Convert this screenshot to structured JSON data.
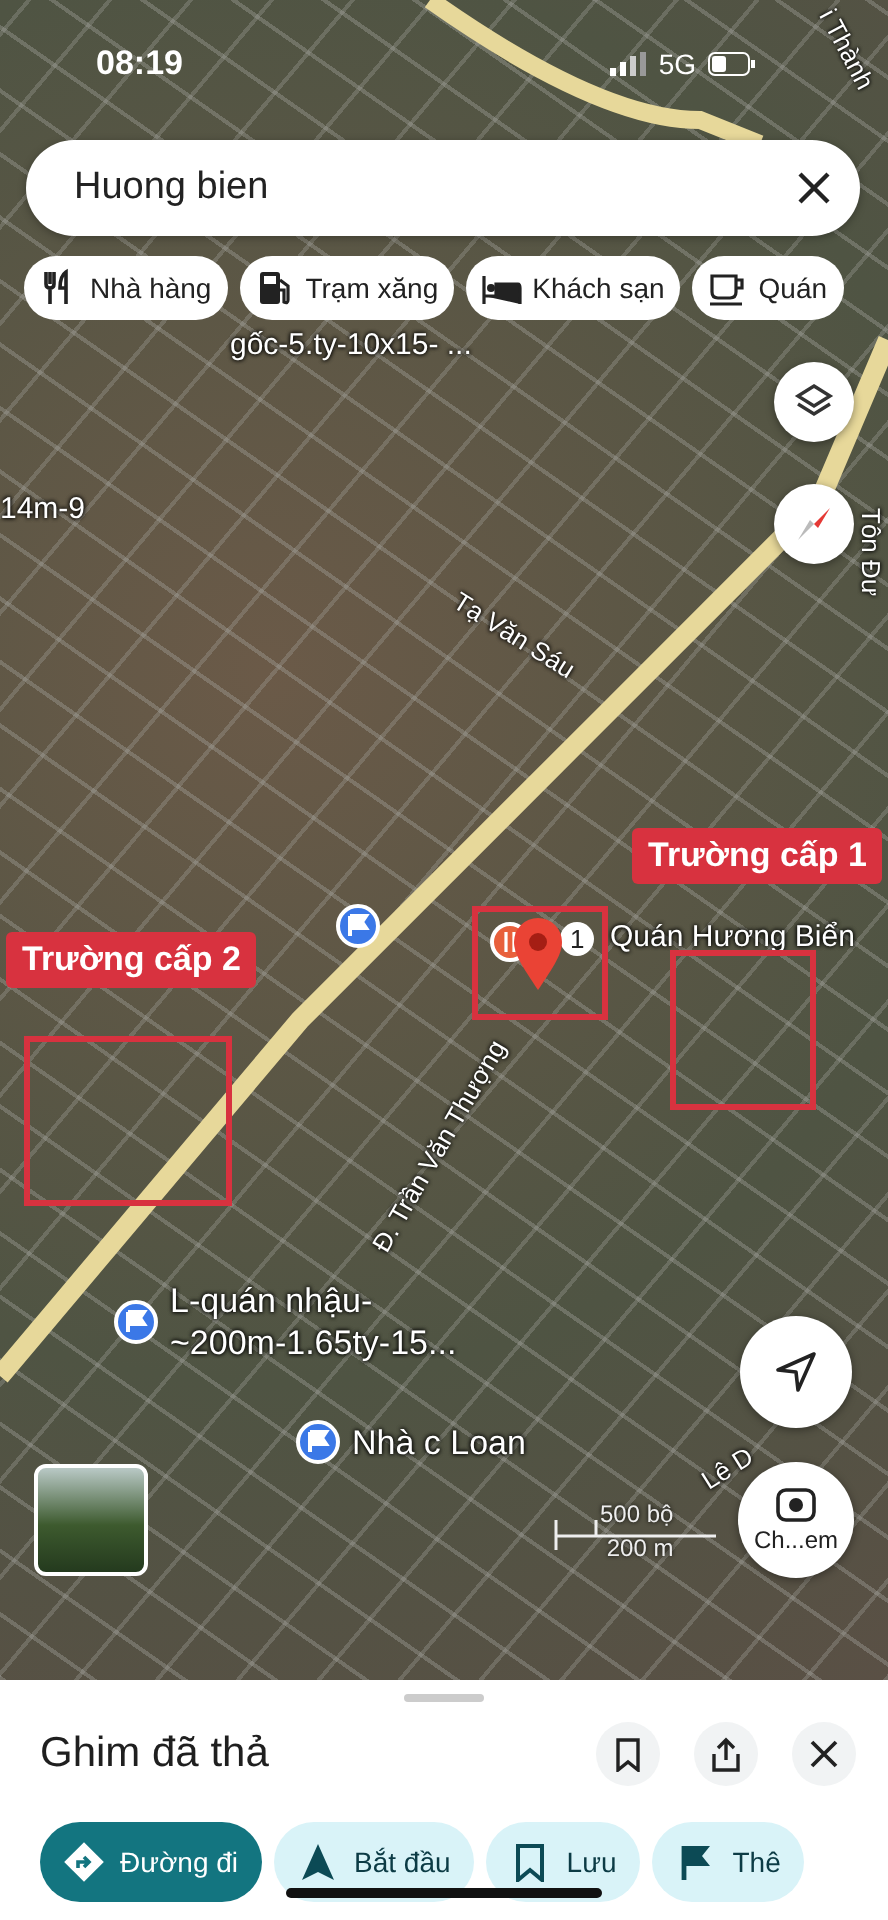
{
  "status_bar": {
    "time": "08:19",
    "network": "5G"
  },
  "search": {
    "value": "Huong bien"
  },
  "chips": [
    {
      "label": "Nhà hàng",
      "kind": "restaurant"
    },
    {
      "label": "Trạm xăng",
      "kind": "fuel"
    },
    {
      "label": "Khách sạn",
      "kind": "hotel"
    },
    {
      "label": "Quán",
      "kind": "cafe"
    }
  ],
  "map": {
    "labels": [
      {
        "text": "i Thành",
        "kind": "street"
      },
      {
        "text": "gốc-5.ty-10x15- ...",
        "kind": "place"
      },
      {
        "text": "14m-9",
        "kind": "place"
      },
      {
        "text": "Tạ Văn Sáu",
        "kind": "street"
      },
      {
        "text": "Tôn Đư",
        "kind": "street"
      },
      {
        "text": "Quán Hương Biển",
        "kind": "place"
      },
      {
        "text": "Đ. Trần Văn Thượng",
        "kind": "street"
      },
      {
        "text": "L-quán nhậu-~200m-1.65ty-15...",
        "kind": "saved"
      },
      {
        "text": "Nhà c Loan",
        "kind": "saved"
      },
      {
        "text": "Lê D",
        "kind": "street"
      }
    ],
    "annotations": [
      "Trường cấp 1",
      "Trường cấp 2"
    ],
    "marker_badge": "1",
    "scale": {
      "imperial": "500 bộ",
      "metric": "200 m"
    },
    "lens_label": "Ch...em"
  },
  "sheet": {
    "title": "Ghim đã thả",
    "actions": [
      {
        "label": "Đường đi",
        "kind": "directions",
        "selected": true
      },
      {
        "label": "Bắt đầu",
        "kind": "start",
        "selected": false
      },
      {
        "label": "Lưu",
        "kind": "save",
        "selected": false
      },
      {
        "label": "Thê",
        "kind": "flag",
        "selected": false
      }
    ]
  }
}
